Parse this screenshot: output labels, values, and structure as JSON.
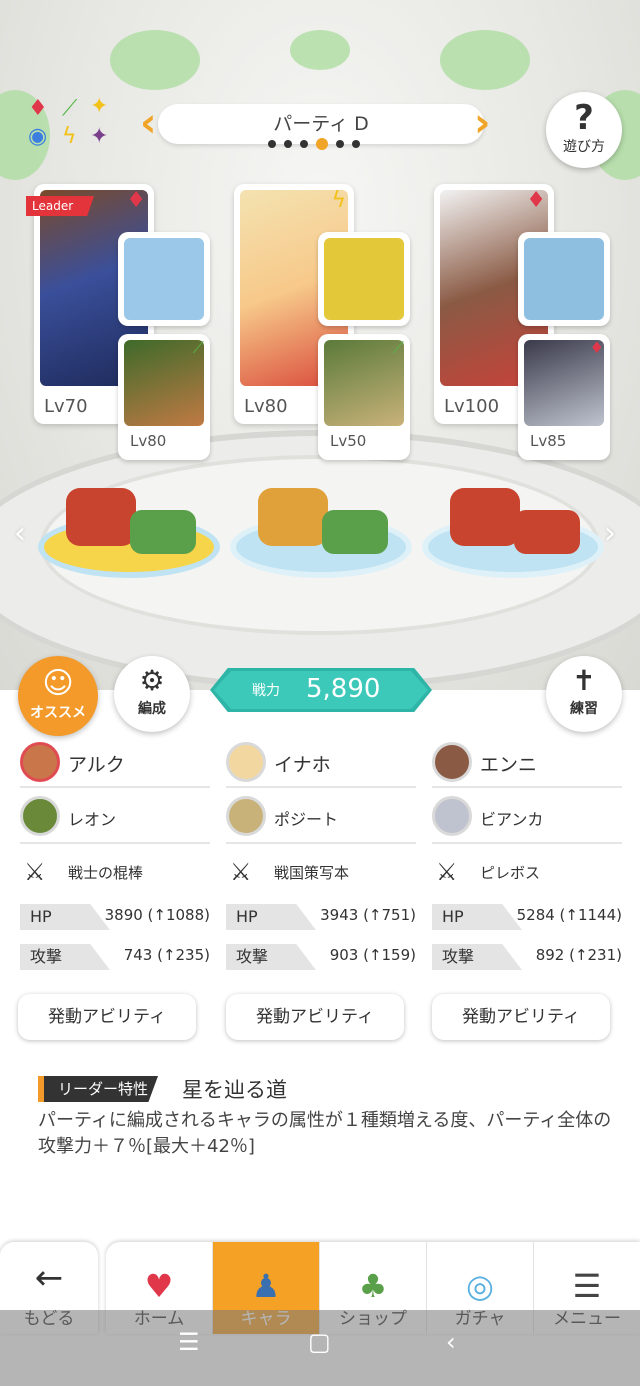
{
  "header": {
    "party_title": "パーティ D",
    "party_dots": [
      false,
      false,
      false,
      true,
      false,
      false
    ],
    "help_label": "遊び方",
    "attributes": [
      "red-diamond",
      "green-leaf",
      "yellow-star",
      "blue-circle",
      "yellow-bolt",
      "purple-star"
    ]
  },
  "party": [
    {
      "leader_tag": "Leader",
      "attribute": "red",
      "main_level": "Lv70",
      "weapon": "staff",
      "sub_attribute": "green",
      "sub_level": "Lv80"
    },
    {
      "leader_tag": "",
      "attribute": "yellow",
      "main_level": "Lv80",
      "weapon": "book-gray",
      "sub_attribute": "green",
      "sub_level": "Lv50"
    },
    {
      "leader_tag": "",
      "attribute": "red",
      "main_level": "Lv100",
      "weapon": "book-gold",
      "sub_attribute": "red",
      "sub_level": "Lv85"
    }
  ],
  "actions": {
    "recommend_label": "オススメ",
    "formation_label": "編成",
    "practice_label": "練習",
    "power_label": "戦力",
    "power_value": "5,890"
  },
  "members": [
    {
      "main": "アルク",
      "sub": "レオン",
      "weapon": "戦士の棍棒",
      "hp_label": "HP",
      "hp": "3890 (↑1088)",
      "atk_label": "攻撃",
      "atk": "743 (↑235)",
      "ability": "発動アビリティ"
    },
    {
      "main": "イナホ",
      "sub": "ポジート",
      "weapon": "戦国策写本",
      "hp_label": "HP",
      "hp": "3943 (↑751)",
      "atk_label": "攻撃",
      "atk": "903 (↑159)",
      "ability": "発動アビリティ"
    },
    {
      "main": "エンニ",
      "sub": "ビアンカ",
      "weapon": "ピレボス",
      "hp_label": "HP",
      "hp": "5284 (↑1144)",
      "atk_label": "攻撃",
      "atk": "892 (↑231)",
      "ability": "発動アビリティ"
    }
  ],
  "leader_skill": {
    "tag": "リーダー特性",
    "name": "星を辿る道",
    "description": "パーティに編成されるキャラの属性が１種類増える度、パーティ全体の攻撃力＋７％[最大＋42％]"
  },
  "nav": {
    "back_label": "もどる",
    "items": [
      {
        "label": "ホーム",
        "icon": "home-icon",
        "active": false
      },
      {
        "label": "キャラ",
        "icon": "character-icon",
        "active": true
      },
      {
        "label": "ショップ",
        "icon": "shop-icon",
        "active": false
      },
      {
        "label": "ガチャ",
        "icon": "gacha-icon",
        "active": false
      },
      {
        "label": "メニュー",
        "icon": "menu-icon",
        "active": false
      }
    ]
  },
  "colors": {
    "accent": "#f39a2a",
    "power": "#3cc9b9",
    "attr_red": "#e0374a",
    "attr_green": "#56b84a",
    "attr_yellow": "#f2c21b"
  }
}
